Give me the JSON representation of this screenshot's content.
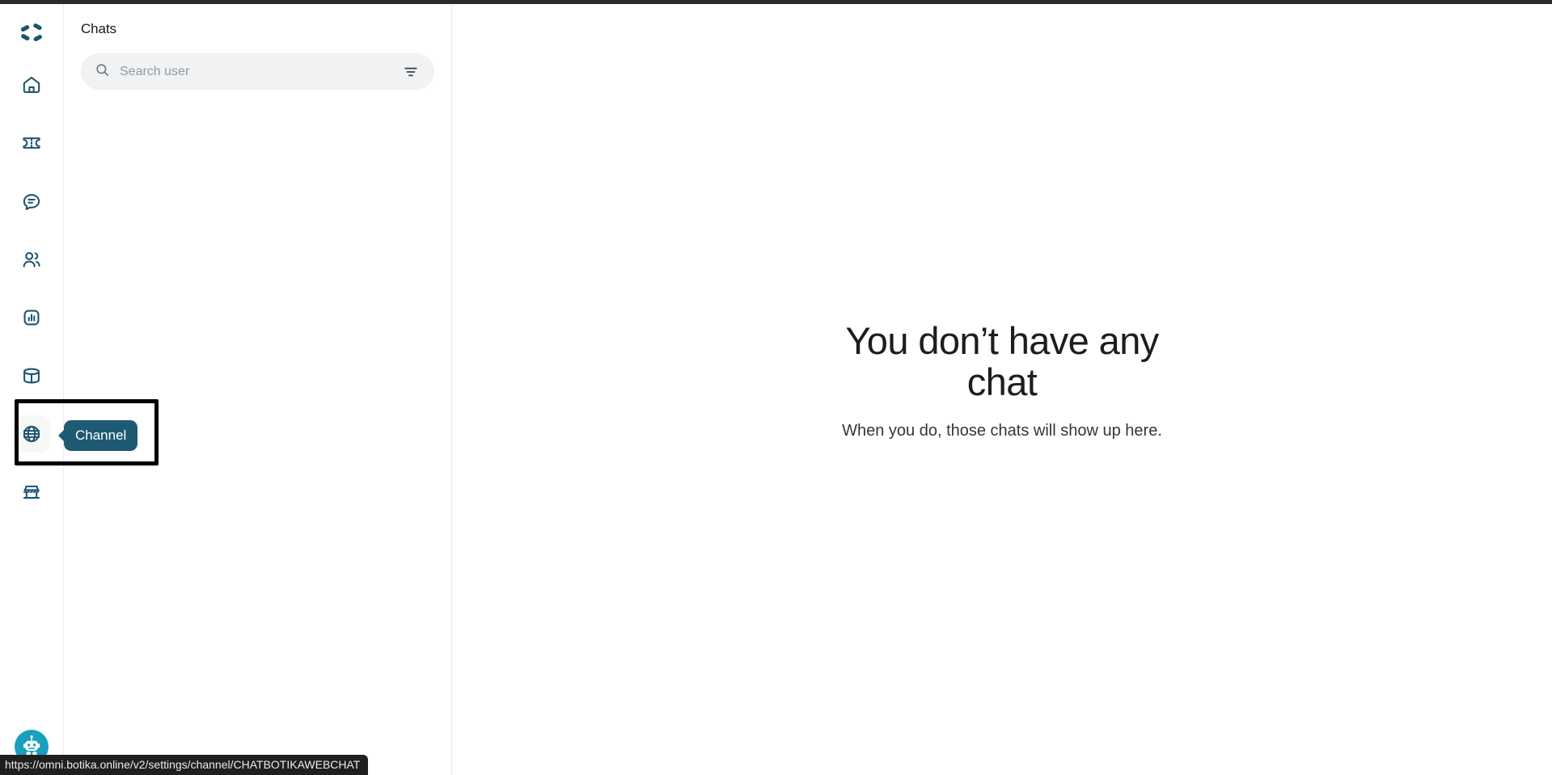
{
  "sidebar": {
    "logo_name": "botika-logo",
    "accent_color": "#1d5470",
    "items": [
      {
        "id": "home",
        "label": "Home",
        "icon": "home-icon",
        "active": false
      },
      {
        "id": "ticket",
        "label": "Ticket",
        "icon": "ticket-icon",
        "active": false
      },
      {
        "id": "chat",
        "label": "Chat",
        "icon": "chat-bubble-icon",
        "active": false
      },
      {
        "id": "contacts",
        "label": "Contacts",
        "icon": "users-icon",
        "active": false
      },
      {
        "id": "analytics",
        "label": "Analytics",
        "icon": "bar-chart-icon",
        "active": false
      },
      {
        "id": "database",
        "label": "Database",
        "icon": "database-icon",
        "active": false
      },
      {
        "id": "channel",
        "label": "Channel",
        "icon": "globe-icon",
        "active": true
      },
      {
        "id": "store",
        "label": "Store",
        "icon": "storefront-icon",
        "active": false
      }
    ],
    "tooltip": {
      "label": "Channel",
      "bg": "#1e5a73",
      "fg": "#ffffff"
    },
    "bottom_avatar": {
      "name": "bot-avatar",
      "bg": "#18a0bc"
    }
  },
  "chat_panel": {
    "title": "Chats",
    "search": {
      "placeholder": "Search user",
      "value": "",
      "icon": "search-icon",
      "filter_icon": "filter-icon"
    },
    "items": []
  },
  "main": {
    "empty_state": {
      "title": "You don’t have any chat",
      "subtitle": "When you do, those chats will show up here."
    }
  },
  "status_bar": {
    "url": "https://omni.botika.online/v2/settings/channel/CHATBOTIKAWEBCHAT"
  }
}
